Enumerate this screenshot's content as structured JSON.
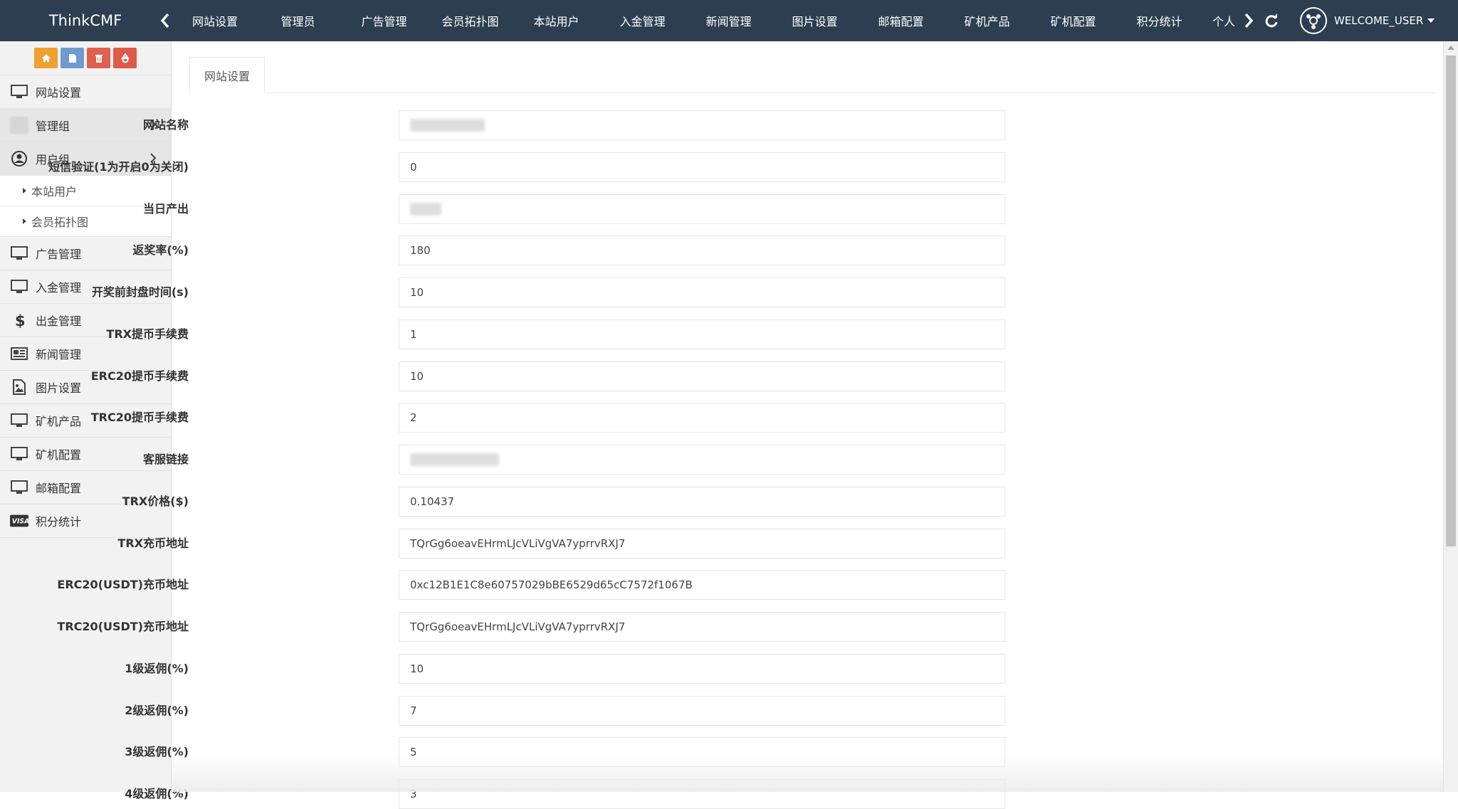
{
  "header": {
    "brand": "ThinkCMF",
    "nav": [
      "网站设置",
      "管理员",
      "广告管理",
      "会员拓扑图",
      "本站用户",
      "入金管理",
      "新闻管理",
      "图片设置",
      "邮箱配置",
      "矿机产品",
      "矿机配置",
      "积分统计",
      "个人"
    ],
    "user": "WELCOME_USER"
  },
  "colors": {
    "topbar": "#2c3e50",
    "shortcut_home": "#f0a030",
    "shortcut_file": "#6f9bd1",
    "shortcut_trash": "#e06050",
    "shortcut_recycle": "#e05a4a"
  },
  "sidebar": {
    "items": [
      {
        "label": "网站设置",
        "icon": "monitor-icon"
      },
      {
        "label": "管理组",
        "icon": "blurred-icon"
      },
      {
        "label": "用户组",
        "icon": "user-circle-icon"
      },
      {
        "label": "本站用户",
        "icon": "triangle-icon"
      },
      {
        "label": "会员拓扑图",
        "icon": "triangle-icon"
      },
      {
        "label": "广告管理",
        "icon": "monitor-icon"
      },
      {
        "label": "入金管理",
        "icon": "monitor-icon"
      },
      {
        "label": "出金管理",
        "icon": "dollar-icon"
      },
      {
        "label": "新闻管理",
        "icon": "newspaper-icon"
      },
      {
        "label": "图片设置",
        "icon": "image-icon"
      },
      {
        "label": "矿机产品",
        "icon": "monitor-icon"
      },
      {
        "label": "矿机配置",
        "icon": "monitor-icon"
      },
      {
        "label": "邮箱配置",
        "icon": "monitor-icon"
      },
      {
        "label": "积分统计",
        "icon": "visa-icon"
      }
    ]
  },
  "main": {
    "tab": "网站设置",
    "fields": [
      {
        "label": "网站名称",
        "value": ""
      },
      {
        "label": "短信验证(1为开启0为关闭)",
        "value": "0"
      },
      {
        "label": "当日产出",
        "value": ""
      },
      {
        "label": "返奖率(%)",
        "value": "180"
      },
      {
        "label": "开奖前封盘时间(s)",
        "value": "10"
      },
      {
        "label": "TRX提币手续费",
        "value": "1"
      },
      {
        "label": "ERC20提币手续费",
        "value": "10"
      },
      {
        "label": "TRC20提币手续费",
        "value": "2"
      },
      {
        "label": "客服链接",
        "value": ""
      },
      {
        "label": "TRX价格($)",
        "value": "0.10437"
      },
      {
        "label": "TRX充币地址",
        "value": "TQrGg6oeavEHrmLJcVLiVgVA7yprrvRXJ7"
      },
      {
        "label": "ERC20(USDT)充币地址",
        "value": "0xc12B1E1C8e60757029bBE6529d65cC7572f1067B"
      },
      {
        "label": "TRC20(USDT)充币地址",
        "value": "TQrGg6oeavEHrmLJcVLiVgVA7yprrvRXJ7"
      },
      {
        "label": "1级返佣(%)",
        "value": "10"
      },
      {
        "label": "2级返佣(%)",
        "value": "7"
      },
      {
        "label": "3级返佣(%)",
        "value": "5"
      },
      {
        "label": "4级返佣(%)",
        "value": "3"
      }
    ]
  }
}
